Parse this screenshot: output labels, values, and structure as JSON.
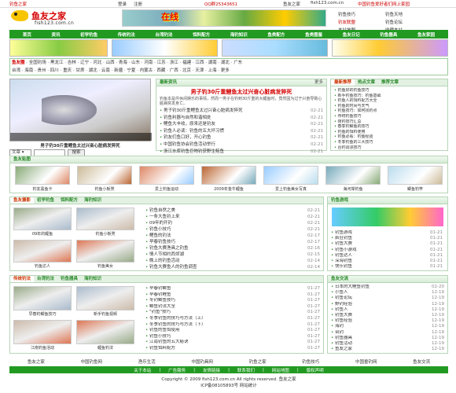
{
  "topbar": {
    "home": "钓鱼之家",
    "qq": "QQ群25343651",
    "site": "鱼友之家",
    "url_label": "fish123.com.cn",
    "slogan": "中国钓鱼爱好者们网上家园",
    "login": "登录",
    "register": "注册"
  },
  "header": {
    "logo_text": "鱼友之家",
    "logo_url": "fish123.com.cn",
    "banner_text": "在线"
  },
  "hdr_links": {
    "items": [
      "钓鱼技巧",
      "钓鱼天地",
      "钓友联盟",
      "钓鱼论坛",
      "本站地图",
      "收藏本站"
    ]
  },
  "nav": {
    "items": [
      "首页",
      "资讯",
      "初学钓鱼",
      "传统钓法",
      "台湾钓法",
      "饵料配方",
      "海钓知识",
      "鱼类配方",
      "鱼类图鉴",
      "鱼友日记",
      "钓鱼器具",
      "鱼友家园"
    ]
  },
  "regions": {
    "label": "鱼友圈",
    "row1": [
      "全国钓场",
      "黑龙江",
      "吉林",
      "辽宁",
      "河北",
      "山西",
      "青海",
      "山东",
      "河南",
      "江苏",
      "浙江",
      "福建",
      "江西",
      "湖南",
      "湖北",
      "广东"
    ],
    "row2": [
      "台湾",
      "海南",
      "贵州",
      "四川",
      "重庆",
      "甘肃",
      "湖北",
      "云南",
      "新疆",
      "宁夏",
      "内蒙古",
      "西藏",
      "广西",
      "北京",
      "天津",
      "上海",
      "更多"
    ]
  },
  "news": {
    "header": "最新资讯",
    "more": "更多",
    "headline": "男子钓30斤重鲤鱼太过兴奋心脏病发猝死",
    "summary": "钓鱼本是件休闲娱乐的事情，然而一男子在钓到30斤重的大鲤鱼时，竟然因为过于兴奋导致心脏病突发身亡。",
    "items": [
      {
        "t": "男子钓30斤重鲤鱼太过兴奋心脏病发猝死",
        "d": "02-21"
      },
      {
        "t": "钓鱼利器与自然和谐相处",
        "d": "02-21"
      },
      {
        "t": "鲤鱼大丰收，原来还是钓友",
        "d": "02-21"
      },
      {
        "t": "钓鱼人必读：钓鱼的五大坏习惯",
        "d": "02-21"
      },
      {
        "t": "钓友们鱼口好，开心钓鱼",
        "d": "02-21"
      },
      {
        "t": "中国钓鱼协会钓鱼活动举行",
        "d": "02-21"
      },
      {
        "t": "浙江水库钓鱼巨物钓获野生鲑鱼",
        "d": "02-21"
      }
    ],
    "slide_caption": "男子钓30斤重鲤鱼太过兴奋心脏病发猝死"
  },
  "search": {
    "select": "文章",
    "button": "搜索"
  },
  "hot": {
    "tab1": "最新推荐",
    "tab2": "热点文章",
    "tab3": "推荐文章",
    "items": [
      "钓鱼好的钓鱼技巧",
      "新手钓鱼技巧：钓鱼基础",
      "钓鱼人的饵料配方大全",
      "钓鱼的时间与天气",
      "钓鱼技巧：如何找钓点",
      "传统钓鱼技巧",
      "夜钓技巧汇总",
      "春季钓鲫鱼的技巧",
      "钓鱼的饵料使用",
      "钓鱼必看：钓鱼经验",
      "冬季钓鱼的三大技巧",
      "台钓调漂技巧"
    ]
  },
  "pics": {
    "header": "鱼友贴图",
    "items": [
      "钓友黑鱼卡",
      "钓鱼小板凳",
      "爱上钓鱼运动",
      "2009年金牛鲤鱼",
      "爱上钓鱼美女写真",
      "海河岸钓鱼",
      "鲫鱼钓竿"
    ]
  },
  "tabs1": {
    "items": [
      "鱼友摄影",
      "初学钓鱼",
      "饵料配方",
      "海钓知识"
    ],
    "pics": [
      "09年的鲤鱼",
      "钓鱼小板凳",
      "钓鱼达人",
      "钓鱼美女"
    ],
    "list": [
      {
        "t": "钓鱼自然之美",
        "d": "02-21"
      },
      {
        "t": "一条大鱼钓上来",
        "d": "02-21"
      },
      {
        "t": "09年的开钓",
        "d": "02-21"
      },
      {
        "t": "钓鱼小技巧",
        "d": "02-21"
      },
      {
        "t": "鲤鱼的钓法",
        "d": "02-17"
      },
      {
        "t": "早春钓鱼技巧",
        "d": "02-17"
      },
      {
        "t": "钓鱼大赛渔具之钓鱼",
        "d": "02-16"
      },
      {
        "t": "情人节相约西郊湖",
        "d": "02-15"
      },
      {
        "t": "晚上的钓鱼活动",
        "d": "02-14"
      },
      {
        "t": "钓鱼大赛鱼人的钓鱼调查",
        "d": "02-14"
      }
    ]
  },
  "games": {
    "header": "钓鱼游戏",
    "items": [
      {
        "t": "钓鱼游戏",
        "d": "01-21"
      },
      {
        "t": "疯狂钓鱼",
        "d": "01-21"
      },
      {
        "t": "钓鱼大赛",
        "d": "01-21"
      },
      {
        "t": "钓鱼小游戏",
        "d": "01-21"
      },
      {
        "t": "钓鱼达人",
        "d": "01-21"
      },
      {
        "t": "深海钓鱼",
        "d": "01-21"
      },
      {
        "t": "快乐钓鱼",
        "d": "01-21"
      }
    ]
  },
  "tabs2": {
    "items": [
      "传统钓法",
      "台湾钓法",
      "钓鱼器具",
      "海钓知识"
    ],
    "pics": [
      "早春钓鲫鱼技巧",
      "新手钓鱼视频",
      "江南钓鱼活动",
      "鲤鱼钓法"
    ],
    "list": [
      {
        "t": "早春钓鲫鱼",
        "d": "01-27"
      },
      {
        "t": "早春钓鲤鱼",
        "d": "01-27"
      },
      {
        "t": "冬钓鲫鱼技巧",
        "d": "01-27"
      },
      {
        "t": "鲫鱼钓法大全",
        "d": "01-27"
      },
      {
        "t": "\"钓鱼\"技巧",
        "d": "01-27"
      },
      {
        "t": "冬季钓鱼的技巧与方法（上）",
        "d": "01-27"
      },
      {
        "t": "冬季钓鱼的技巧与方法（下）",
        "d": "01-27"
      },
      {
        "t": "钓鱼的鱼饵使用",
        "d": "01-27"
      },
      {
        "t": "钓鱼小技巧",
        "d": "01-27"
      },
      {
        "t": "江南钓鱼的五大秘诀",
        "d": "01-27"
      },
      {
        "t": "钓鱼饵料配方",
        "d": "01-27"
      }
    ]
  },
  "friends": {
    "header": "鱼友交流",
    "items": [
      {
        "t": "日本的大鲤鱼钓鱼",
        "d": "02-20"
      },
      {
        "t": "小鱼人",
        "d": "12-19"
      },
      {
        "t": "钓鱼论坛",
        "d": "12-19"
      },
      {
        "t": "野钓经验",
        "d": "12-19"
      },
      {
        "t": "钓鱼人",
        "d": "12-19"
      },
      {
        "t": "钓鱼大赛",
        "d": "12-19"
      },
      {
        "t": "钓鱼经验",
        "d": "12-19"
      },
      {
        "t": "海钓",
        "d": "12-19"
      },
      {
        "t": "台钓",
        "d": "12-19"
      },
      {
        "t": "钓鱼器具",
        "d": "12-19"
      },
      {
        "t": "钓鱼活动",
        "d": "12-19"
      },
      {
        "t": "鱼友之家",
        "d": "12-19"
      }
    ]
  },
  "partners": {
    "items": [
      "鱼友之家",
      "中国钓鱼网",
      "渔乐生活",
      "中国钓具网",
      "钓鱼之家",
      "钓鱼技巧",
      "中国垂钓网",
      "鱼友交流"
    ]
  },
  "bottomnav": {
    "items": [
      "关于本站",
      "广告服务",
      "友情链接",
      "联系我们",
      "网站地图",
      "版权声明"
    ]
  },
  "copyright": {
    "line1": "Copyright © 2009 fish123.com.cn All rights reserved. 鱼友之家",
    "line2": "ICP备08105893号 网站统计"
  },
  "colors": {
    "nav": "#229a22",
    "accent": "#d40000",
    "section": "#2a8a2a"
  }
}
